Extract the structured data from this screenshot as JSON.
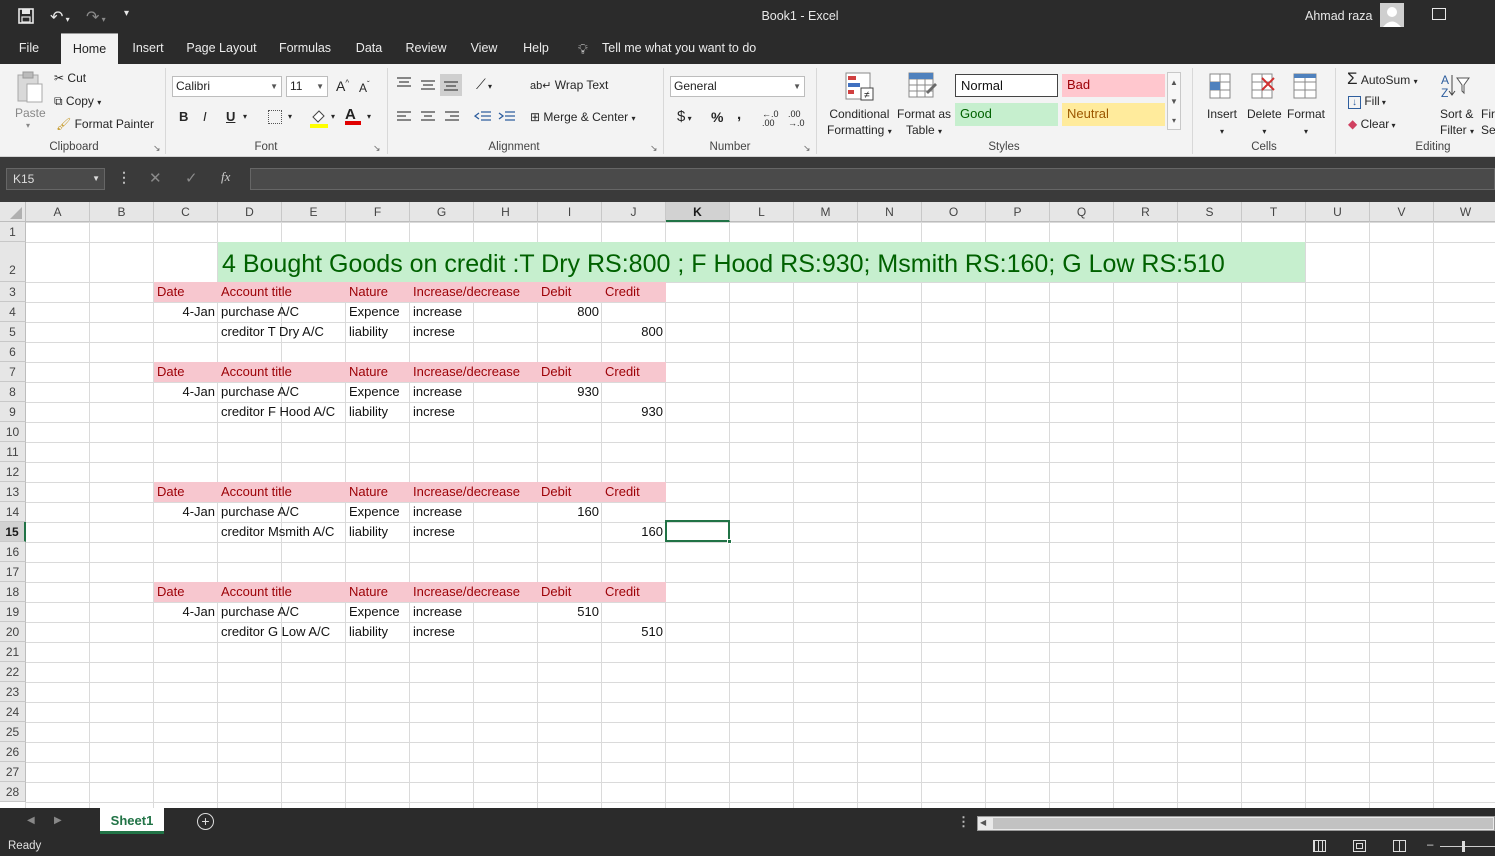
{
  "window": {
    "title": "Book1  -  Excel",
    "user": "Ahmad raza"
  },
  "ribbon_tabs": [
    "File",
    "Home",
    "Insert",
    "Page Layout",
    "Formulas",
    "Data",
    "Review",
    "View",
    "Help"
  ],
  "tell_me": "Tell me what you want to do",
  "clipboard": {
    "paste": "Paste",
    "cut": "Cut",
    "copy": "Copy",
    "format_painter": "Format Painter",
    "label": "Clipboard"
  },
  "font": {
    "name": "Calibri",
    "size": "11",
    "label": "Font",
    "bold": "B",
    "italic": "I",
    "underline": "U",
    "grow": "A",
    "shrink": "A"
  },
  "alignment": {
    "wrap": "Wrap Text",
    "merge": "Merge & Center",
    "label": "Alignment"
  },
  "number": {
    "format": "General",
    "currency": "$",
    "percent": "%",
    "comma": ",",
    "label": "Number"
  },
  "styles": {
    "conditional": "Conditional",
    "conditional2": "Formatting",
    "format_as": "Format as",
    "format_as2": "Table",
    "normal": "Normal",
    "bad": "Bad",
    "good": "Good",
    "neutral": "Neutral",
    "label": "Styles"
  },
  "cells": {
    "insert": "Insert",
    "delete": "Delete",
    "format": "Format",
    "label": "Cells"
  },
  "editing": {
    "autosum": "AutoSum",
    "fill": "Fill",
    "clear": "Clear",
    "sort": "Sort &",
    "sort2": "Filter",
    "find": "Fir",
    "find2": "Sel",
    "label": "Editing"
  },
  "formula_bar": {
    "name_box": "K15",
    "fx": "fx",
    "value": ""
  },
  "columns": [
    "A",
    "B",
    "C",
    "D",
    "E",
    "F",
    "G",
    "H",
    "I",
    "J",
    "K",
    "L",
    "M",
    "N",
    "O",
    "P",
    "Q",
    "R",
    "S",
    "T",
    "U",
    "V",
    "W"
  ],
  "rows": [
    "1",
    "2",
    "3",
    "4",
    "5",
    "6",
    "7",
    "8",
    "9",
    "10",
    "11",
    "12",
    "13",
    "14",
    "15",
    "16",
    "17",
    "18",
    "19",
    "20",
    "21",
    "22",
    "23",
    "24",
    "25",
    "26",
    "27",
    "28"
  ],
  "selected_cell": {
    "column": "K",
    "row": "15"
  },
  "sheet": {
    "title": "4 Bought Goods on credit :T Dry RS:800 ; F Hood RS:930; Msmith RS:160; G Low RS:510",
    "header": {
      "date": "Date",
      "account": "Account title",
      "nature": "Nature",
      "incdec": "Increase/decrease",
      "debit": "Debit",
      "credit": "Credit"
    },
    "entries": [
      {
        "date": "4-Jan",
        "r1_account": "purchase A/C",
        "r1_nature": "Expence",
        "r1_incdec": "increase",
        "r1_debit": "800",
        "r2_account": "creditor T Dry A/C",
        "r2_nature": "liability",
        "r2_incdec": "increse",
        "r2_credit": "800"
      },
      {
        "date": "4-Jan",
        "r1_account": "purchase A/C",
        "r1_nature": "Expence",
        "r1_incdec": "increase",
        "r1_debit": "930",
        "r2_account": "creditor F Hood A/C",
        "r2_nature": "liability",
        "r2_incdec": "increse",
        "r2_credit": "930"
      },
      {
        "date": "4-Jan",
        "r1_account": "purchase A/C",
        "r1_nature": "Expence",
        "r1_incdec": "increase",
        "r1_debit": "160",
        "r2_account": "creditor Msmith A/C",
        "r2_nature": "liability",
        "r2_incdec": "increse",
        "r2_credit": "160"
      },
      {
        "date": "4-Jan",
        "r1_account": "purchase A/C",
        "r1_nature": "Expence",
        "r1_incdec": "increase",
        "r1_debit": "510",
        "r2_account": "creditor G Low A/C",
        "r2_nature": "liability",
        "r2_incdec": "increse",
        "r2_credit": "510"
      }
    ]
  },
  "sheet_tabs": [
    "Sheet1"
  ],
  "status": "Ready",
  "colors": {
    "accent": "#217346",
    "title_bg": "#c6efce",
    "title_fg": "#006100",
    "hdr_bg": "#f7c7cf",
    "hdr_fg": "#9c0006"
  }
}
